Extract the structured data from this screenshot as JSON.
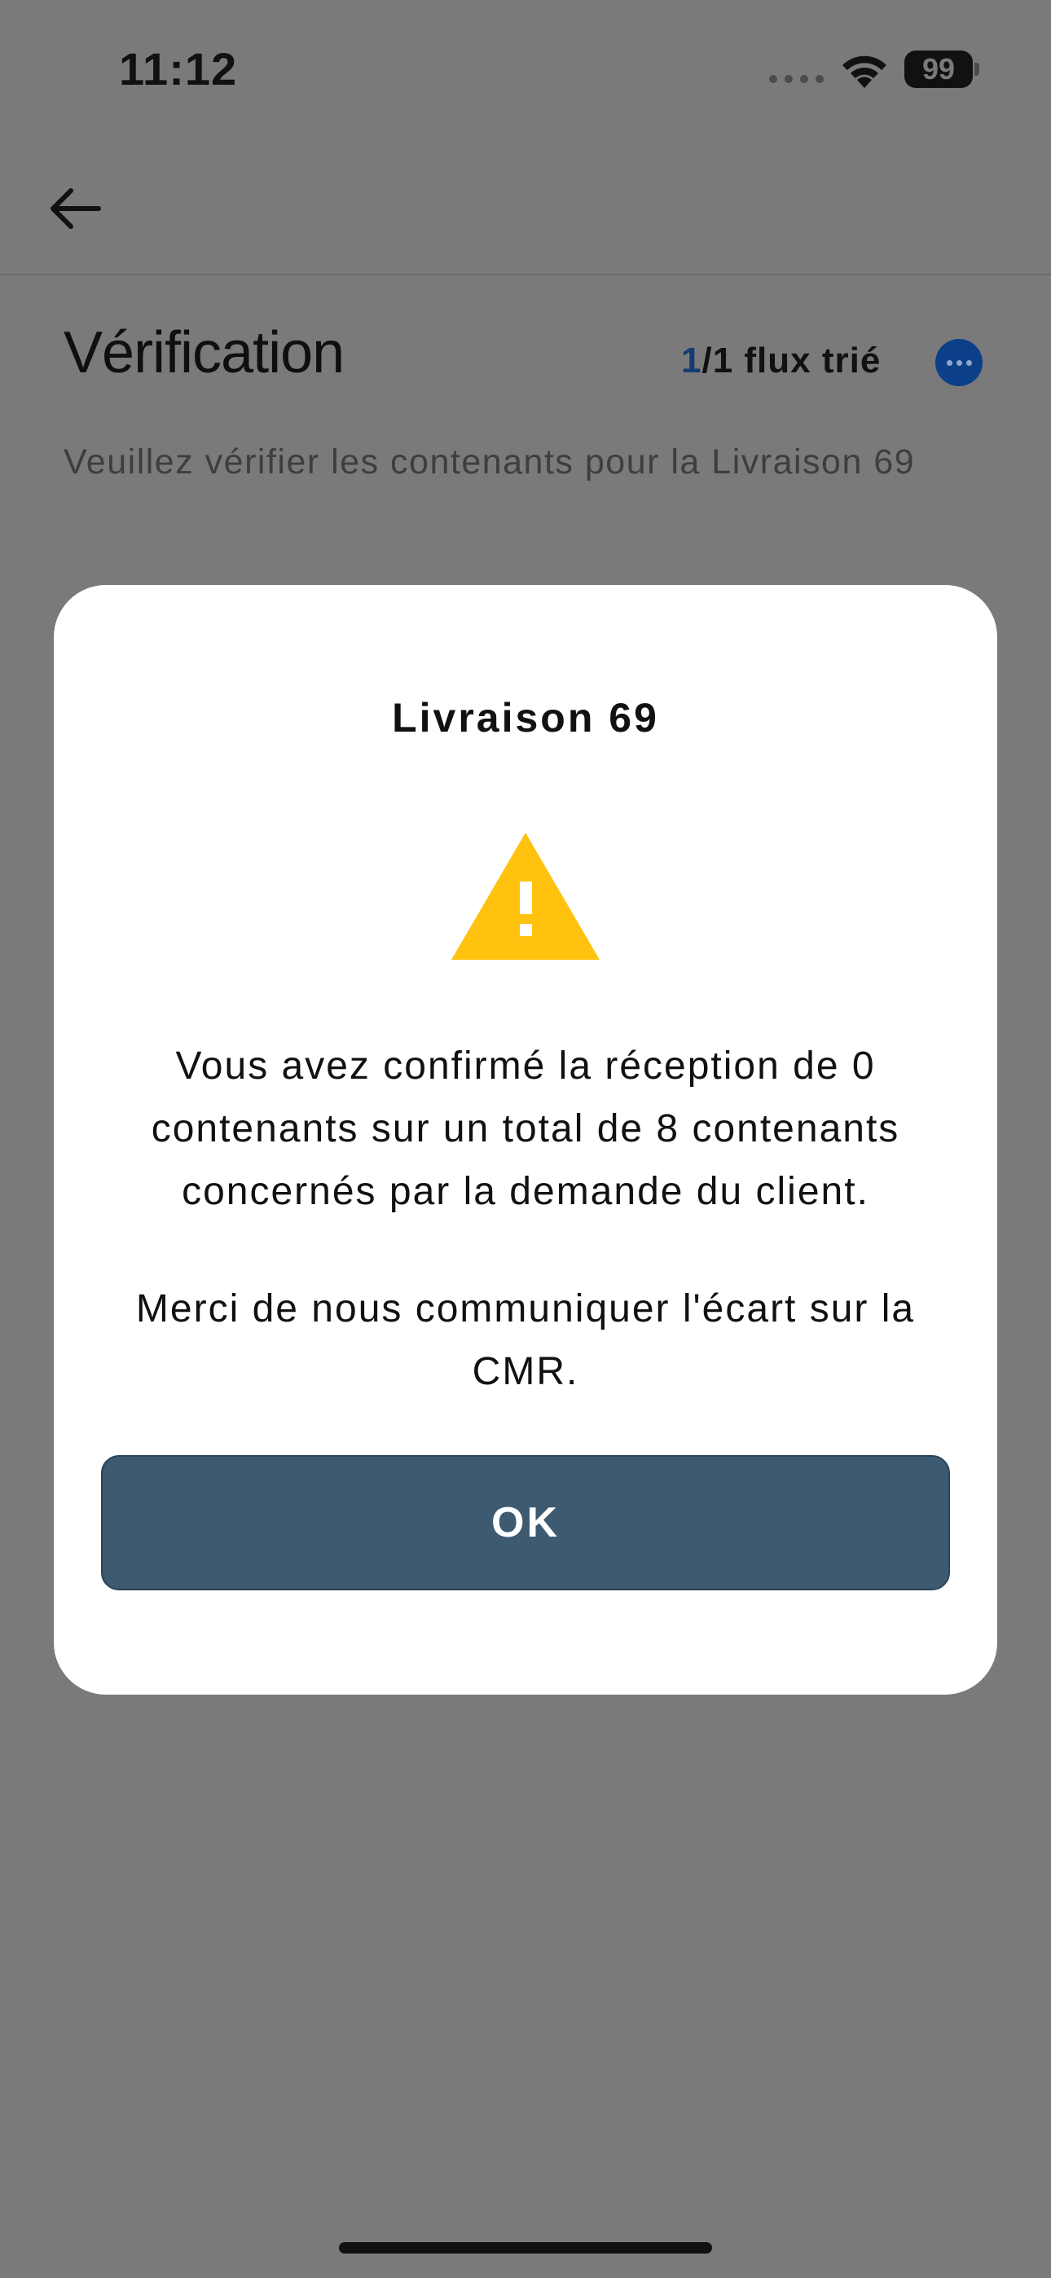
{
  "status_bar": {
    "time": "11:12",
    "battery_level": "99"
  },
  "header": {
    "back_icon": "arrow-left-icon"
  },
  "page": {
    "title": "Vérification",
    "flux_current": "1",
    "flux_rest": "/1 flux trié",
    "more_icon": "ellipsis-icon",
    "subtitle": "Veuillez vérifier les contenants pour la Livraison 69"
  },
  "modal": {
    "title": "Livraison 69",
    "icon": "warning-icon",
    "message_1": "Vous avez confirmé la réception de 0 contenants sur un total de 8 contenants concernés par la demande du client.",
    "message_2": "Merci de nous communiquer l'écart sur la CMR.",
    "ok_label": "OK"
  },
  "colors": {
    "overlay": "#7a7a7a",
    "accent_blue": "#0b3f8a",
    "button": "#3d5a71",
    "warning": "#ffc20e"
  }
}
